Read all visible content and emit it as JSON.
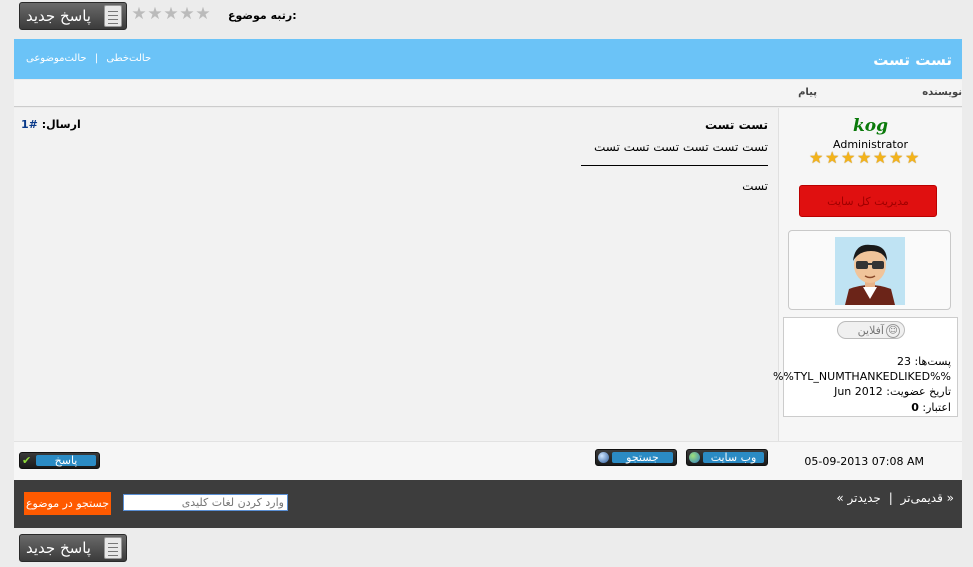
{
  "toolbar": {
    "reply_label": "پاسخ جدید",
    "rating_label": "رتبه موضوع:",
    "rating_value": 0,
    "rating_max": 5
  },
  "thread": {
    "title": "تست تست",
    "links": [
      "حالت‌موضوعی",
      "حالت‌خطی"
    ],
    "col_author": "نویسنده",
    "col_message": "پیام"
  },
  "author": {
    "name": "kog",
    "title": "Administrator",
    "stars": 7,
    "rank_label": "مدیریت کل سایت",
    "status": "آفلاین",
    "posts_line": "پست‌ها: 23",
    "thanks_line": "%%TYL_NUMTHANKEDLIKED%%",
    "joined_line": "تاریخ عضویت: Jun 2012",
    "reputation_label": "اعتبار:",
    "reputation_value": "0"
  },
  "post": {
    "title": "تست تست",
    "number_label": "ارسال:",
    "number": "#1",
    "line1": "تست تست تست تست تست تست",
    "line2": "تست",
    "date": "05-09-2013 07:08 AM"
  },
  "actions": {
    "website": "وب سایت",
    "search": "جستجو",
    "reply": "پاسخ"
  },
  "nav": {
    "older": "« قدیمی‌تر",
    "sep": "|",
    "newer": "جدیدتر »"
  },
  "search": {
    "placeholder": "وارد کردن لغات کلیدی",
    "button": "جستجو در موضوع"
  },
  "colors": {
    "title_bar": "#6bc3f7",
    "nav_bar": "#3d3d3d",
    "search_button": "#ff5a00",
    "rank": "#e01010",
    "username": "#0a7a0a"
  }
}
